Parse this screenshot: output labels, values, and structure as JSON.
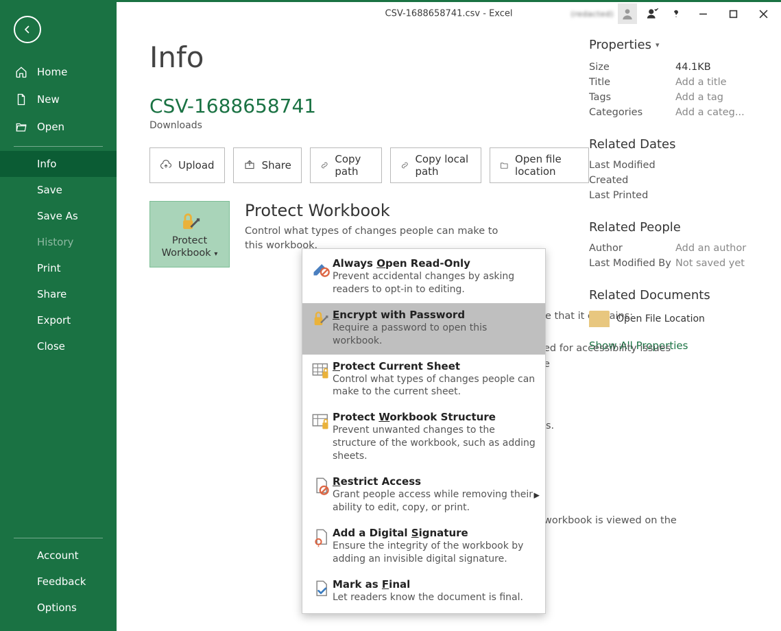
{
  "window": {
    "title": "CSV-1688658741.csv  -  Excel",
    "username": "(redacted)"
  },
  "sidebar": {
    "items": [
      {
        "key": "home",
        "label": "Home"
      },
      {
        "key": "new",
        "label": "New"
      },
      {
        "key": "open",
        "label": "Open"
      },
      {
        "key": "info",
        "label": "Info"
      },
      {
        "key": "save",
        "label": "Save"
      },
      {
        "key": "saveas",
        "label": "Save As"
      },
      {
        "key": "history",
        "label": "History"
      },
      {
        "key": "print",
        "label": "Print"
      },
      {
        "key": "share",
        "label": "Share"
      },
      {
        "key": "export",
        "label": "Export"
      },
      {
        "key": "close",
        "label": "Close"
      }
    ],
    "bottom": [
      {
        "key": "account",
        "label": "Account"
      },
      {
        "key": "feedback",
        "label": "Feedback"
      },
      {
        "key": "options",
        "label": "Options"
      }
    ]
  },
  "page": {
    "title": "Info",
    "filename": "CSV-1688658741",
    "filepath": "Downloads",
    "buttons": {
      "upload": "Upload",
      "share": "Share",
      "copy_path": "Copy path",
      "copy_local": "Copy local path",
      "open_loc": "Open file location"
    },
    "protect": {
      "button_label": "Protect Workbook",
      "heading": "Protect Workbook",
      "desc": "Control what types of changes people can make to this workbook."
    },
    "issues_partial_1": "e that it contains:",
    "issues_partial_2": "ed for accessibility issues",
    "issues_partial_3": "e",
    "issues_partial_4": "s.",
    "issues_partial_5": "workbook is viewed on the",
    "menu": {
      "readonly": {
        "title_pre": "Always ",
        "title_u": "O",
        "title_post": "pen Read-Only",
        "desc": "Prevent accidental changes by asking readers to opt-in to editing."
      },
      "encrypt": {
        "title_pre": "",
        "title_u": "E",
        "title_post": "ncrypt with Password",
        "desc": "Require a password to open this workbook."
      },
      "sheet": {
        "title_pre": "",
        "title_u": "P",
        "title_post": "rotect Current Sheet",
        "desc": "Control what types of changes people can make to the current sheet."
      },
      "struct": {
        "title_pre": "Protect ",
        "title_u": "W",
        "title_post": "orkbook Structure",
        "desc": "Prevent unwanted changes to the structure of the workbook, such as adding sheets."
      },
      "restrict": {
        "title_pre": "",
        "title_u": "R",
        "title_post": "estrict Access",
        "desc": "Grant people access while removing their ability to edit, copy, or print."
      },
      "sign": {
        "title_pre": "Add a Digital ",
        "title_u": "S",
        "title_post": "ignature",
        "desc": "Ensure the integrity of the workbook by adding an invisible digital signature."
      },
      "final": {
        "title_pre": "Mark as ",
        "title_u": "F",
        "title_post": "inal",
        "desc": "Let readers know the document is final."
      }
    }
  },
  "props": {
    "header": "Properties",
    "rows": {
      "size": {
        "k": "Size",
        "v": "44.1KB"
      },
      "title": {
        "k": "Title",
        "v": "Add a title"
      },
      "tags": {
        "k": "Tags",
        "v": "Add a tag"
      },
      "categories": {
        "k": "Categories",
        "v": "Add a categ..."
      }
    },
    "dates_header": "Related Dates",
    "dates": {
      "modified": "Last Modified",
      "created": "Created",
      "printed": "Last Printed"
    },
    "people_header": "Related People",
    "people": {
      "author_k": "Author",
      "author_v": "Add an author",
      "modby_k": "Last Modified By",
      "modby_v": "Not saved yet"
    },
    "docs_header": "Related Documents",
    "open_loc": "Open File Location",
    "show_all": "Show All Properties"
  }
}
